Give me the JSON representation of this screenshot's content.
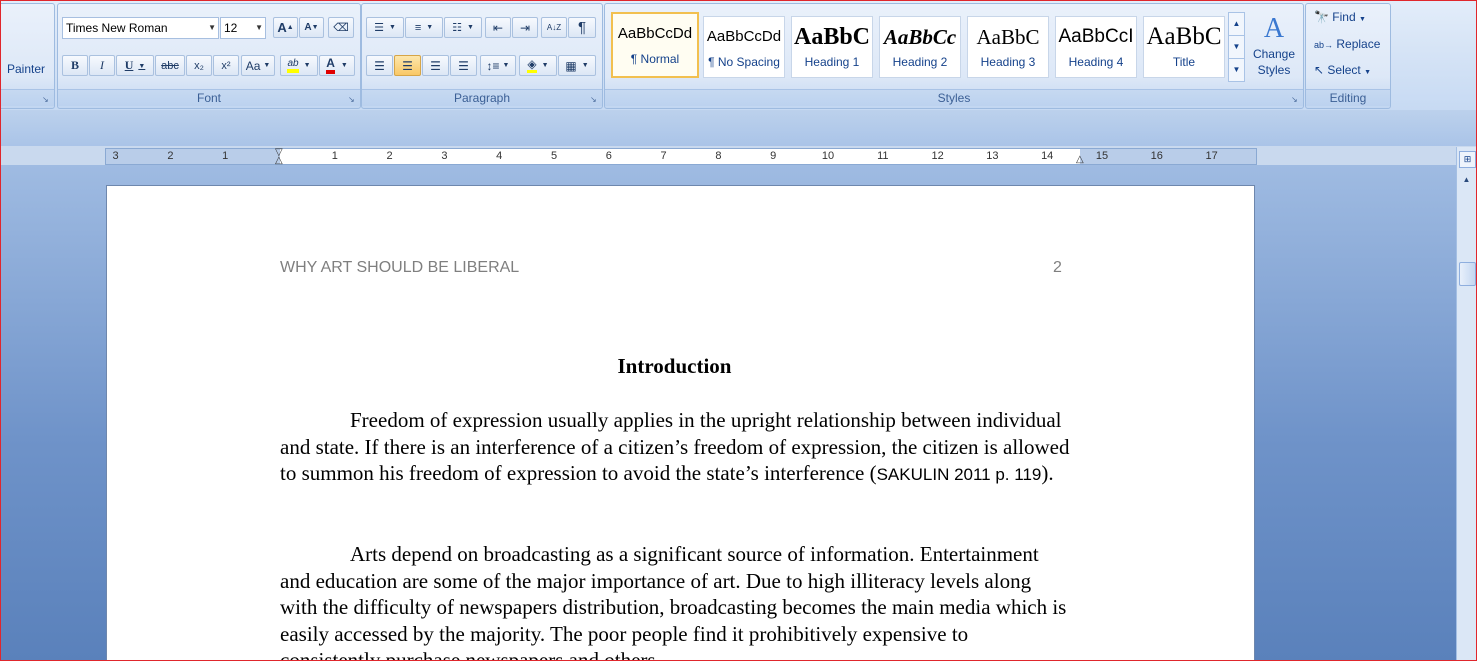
{
  "clipboard": {
    "painter_label": "Painter"
  },
  "font": {
    "group_label": "Font",
    "family_value": "Times New Roman",
    "size_value": "12",
    "grow_label": "A",
    "shrink_label": "A",
    "bold_label": "B",
    "italic_label": "I",
    "underline_label": "U",
    "strike_label": "abc",
    "subscript_label": "x₂",
    "superscript_label": "x²",
    "case_label": "Aa",
    "highlight_label": "ab",
    "color_label": "A"
  },
  "paragraph": {
    "group_label": "Paragraph",
    "pilcrow": "¶",
    "sort_label": "A↓Z"
  },
  "styles": {
    "group_label": "Styles",
    "change_styles_label": "Change Styles",
    "items": [
      {
        "preview": "AaBbCcDd",
        "name": "¶ Normal"
      },
      {
        "preview": "AaBbCcDd",
        "name": "¶ No Spacing"
      },
      {
        "preview": "AaBbC",
        "name": "Heading 1"
      },
      {
        "preview": "AaBbCc",
        "name": "Heading 2"
      },
      {
        "preview": "AaBbC",
        "name": "Heading 3"
      },
      {
        "preview": "AaBbCcI",
        "name": "Heading 4"
      },
      {
        "preview": "AaBbC",
        "name": "Title"
      }
    ]
  },
  "editing": {
    "group_label": "Editing",
    "find_label": "Find",
    "replace_label": "Replace",
    "select_label": "Select"
  },
  "ruler": {
    "ticks": [
      "3",
      "2",
      "1",
      "1",
      "2",
      "3",
      "4",
      "5",
      "6",
      "7",
      "8",
      "9",
      "10",
      "11",
      "12",
      "13",
      "14",
      "15",
      "16",
      "17"
    ]
  },
  "document": {
    "header_text": "WHY ART SHOULD BE LIBERAL",
    "page_number": "2",
    "heading": "Introduction",
    "para1_main": "Freedom of expression usually applies in the upright relationship between individual and state. If there is an interference of a citizen’s freedom of expression, the citizen is allowed to summon his freedom of expression to avoid the state’s interference (",
    "para1_cite": "SAKULIN 2011 p. 119",
    "para1_end": ").",
    "para2": "Arts depend on broadcasting as a significant source of information. Entertainment and education are some of the major importance of art. Due to high illiteracy levels along with the difficulty of newspapers distribution, broadcasting becomes the main media which is easily accessed by the majority. The poor people find it prohibitively expensive to consistently purchase newspapers and others"
  },
  "colors": {
    "highlight": "#ffff00",
    "font_color": "#e00000",
    "accent": "#f2c04f"
  }
}
